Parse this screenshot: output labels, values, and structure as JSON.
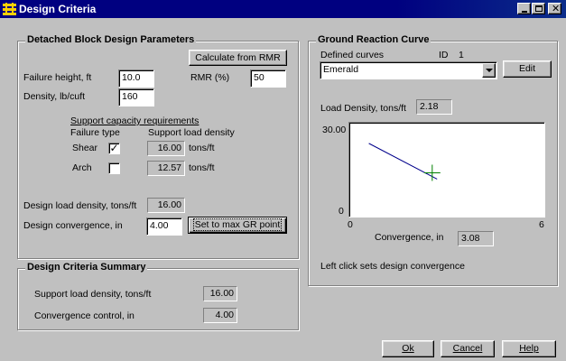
{
  "window": {
    "title": "Design Criteria"
  },
  "detached": {
    "title": "Detached Block Design Parameters",
    "calc_button": "Calculate from RMR",
    "failure_height_label": "Failure height, ft",
    "failure_height_value": "10.0",
    "rmr_label": "RMR (%)",
    "rmr_value": "50",
    "density_label": "Density, lb/cuft",
    "density_value": "160",
    "support_heading": "Support capacity requirements",
    "failure_type_header": "Failure type",
    "support_density_header": "Support load density",
    "shear_label": "Shear",
    "shear_checked": true,
    "shear_value": "16.00",
    "arch_label": "Arch",
    "arch_checked": false,
    "arch_value": "12.57",
    "unit_tons_ft": "tons/ft",
    "design_load_label": "Design load density, tons/ft",
    "design_load_value": "16.00",
    "design_conv_label": "Design convergence, in",
    "design_conv_value": "4.00",
    "set_max_button": "Set to max GR point"
  },
  "summary": {
    "title": "Design Criteria Summary",
    "support_label": "Support load density, tons/ft",
    "support_value": "16.00",
    "conv_label": "Convergence control, in",
    "conv_value": "4.00"
  },
  "grc": {
    "title": "Ground Reaction Curve",
    "defined_curves_label": "Defined curves",
    "id_label": "ID",
    "id_value": "1",
    "curve_selected": "Emerald",
    "edit_button": "Edit",
    "load_density_label": "Load Density, tons/ft",
    "load_density_value": "2.18",
    "conv_label": "Convergence, in",
    "conv_value": "3.08",
    "hint": "Left click sets design convergence"
  },
  "chart_data": {
    "type": "line",
    "title": "",
    "xlabel": "Convergence, in",
    "ylabel": "",
    "xlim": [
      0,
      6
    ],
    "ylim": [
      0,
      30
    ],
    "x_tick_labels": [
      "0",
      "6"
    ],
    "y_tick_labels": [
      "30.00",
      "0"
    ],
    "series": [
      {
        "x": [
          0.6,
          2.7
        ],
        "y": [
          23.4,
          12.0
        ],
        "color": "#00008b"
      }
    ],
    "marker": {
      "x": 2.55,
      "y": 14.0,
      "color": "#008000"
    }
  },
  "footer": {
    "ok": "Ok",
    "cancel": "Cancel",
    "help": "Help"
  }
}
